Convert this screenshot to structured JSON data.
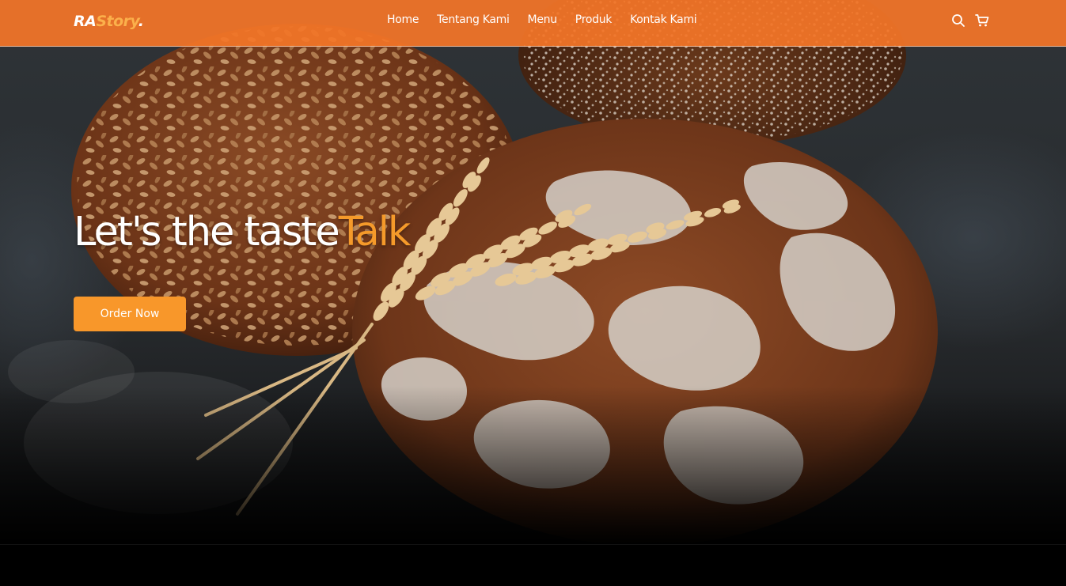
{
  "brand": {
    "part1": "RA",
    "part2": "Story",
    "part3": "."
  },
  "nav": {
    "links": [
      "Home",
      "Tentang Kami",
      "Menu",
      "Produk",
      "Kontak Kami"
    ],
    "icons": [
      "search-icon",
      "cart-icon"
    ]
  },
  "hero": {
    "title_main": "Let's the taste",
    "title_accent": "Talk",
    "cta_label": "Order Now",
    "image_subject": "rustic breads with seeds and wheat stalks on dark wooden table"
  },
  "colors": {
    "navbar": "#f37528",
    "accent": "#f59a2a",
    "button": "#f8972a",
    "logo_accent": "#fbb04b"
  }
}
